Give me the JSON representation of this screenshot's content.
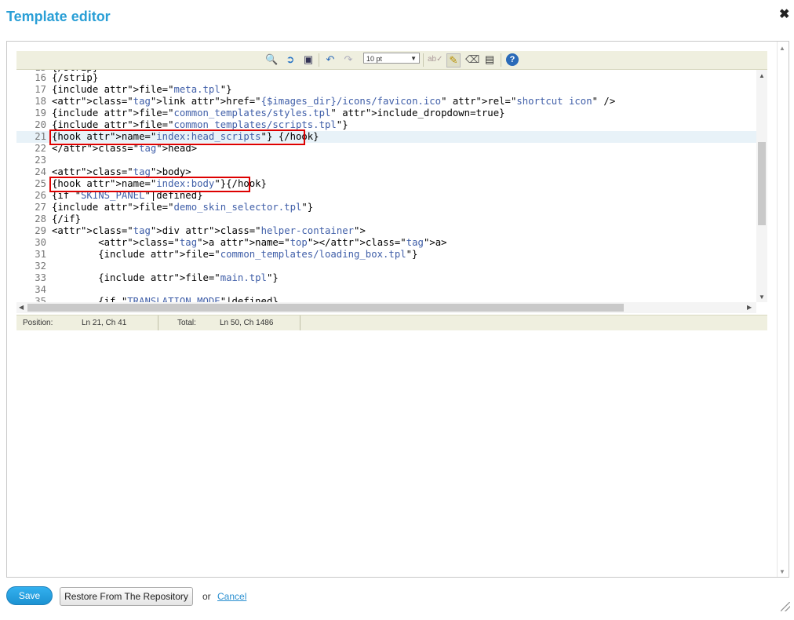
{
  "dialog": {
    "title": "Template editor",
    "close_symbol": "✖"
  },
  "toolbar": {
    "icons": [
      "find-icon",
      "goto-line-icon",
      "fullscreen-icon",
      "undo-icon",
      "redo-icon",
      "font-size-select",
      "spellcheck-icon",
      "highlight-icon",
      "reset-icon",
      "toggle-editor-icon",
      "help-icon"
    ],
    "font_size": "10 pt"
  },
  "editor": {
    "lines": [
      {
        "n": "16",
        "text": "{/strip}"
      },
      {
        "n": "17",
        "text": "{include file=\"meta.tpl\"}"
      },
      {
        "n": "18",
        "text": "<link href=\"{$images_dir}/icons/favicon.ico\" rel=\"shortcut icon\" />"
      },
      {
        "n": "19",
        "text": "{include file=\"common_templates/styles.tpl\" include_dropdown=true}"
      },
      {
        "n": "20",
        "text": "{include file=\"common_templates/scripts.tpl\"}"
      },
      {
        "n": "21",
        "text": "{hook name=\"index:head_scripts\"} {/hook}"
      },
      {
        "n": "22",
        "text": "</head>"
      },
      {
        "n": "23",
        "text": ""
      },
      {
        "n": "24",
        "text": "<body>"
      },
      {
        "n": "25",
        "text": "{hook name=\"index:body\"}{/hook}"
      },
      {
        "n": "26",
        "text": "{if \"SKINS_PANEL\"|defined}"
      },
      {
        "n": "27",
        "text": "{include file=\"demo_skin_selector.tpl\"}"
      },
      {
        "n": "28",
        "text": "{/if}"
      },
      {
        "n": "29",
        "text": "<div class=\"helper-container\">"
      },
      {
        "n": "30",
        "text": "        <a name=\"top\"></a>"
      },
      {
        "n": "31",
        "text": "        {include file=\"common_templates/loading_box.tpl\"}"
      },
      {
        "n": "32",
        "text": ""
      },
      {
        "n": "33",
        "text": "        {include file=\"main.tpl\"}"
      },
      {
        "n": "34",
        "text": ""
      },
      {
        "n": "35",
        "text": "        {if \"TRANSLATION_MODE\"|defined}"
      }
    ],
    "active_line": "21"
  },
  "status": {
    "position_label": "Position:",
    "position_value": "Ln 21, Ch 41",
    "total_label": "Total:",
    "total_value": "Ln 50, Ch 1486"
  },
  "buttons": {
    "save": "Save",
    "restore": "Restore From The Repository",
    "or": "or",
    "cancel": "Cancel"
  }
}
